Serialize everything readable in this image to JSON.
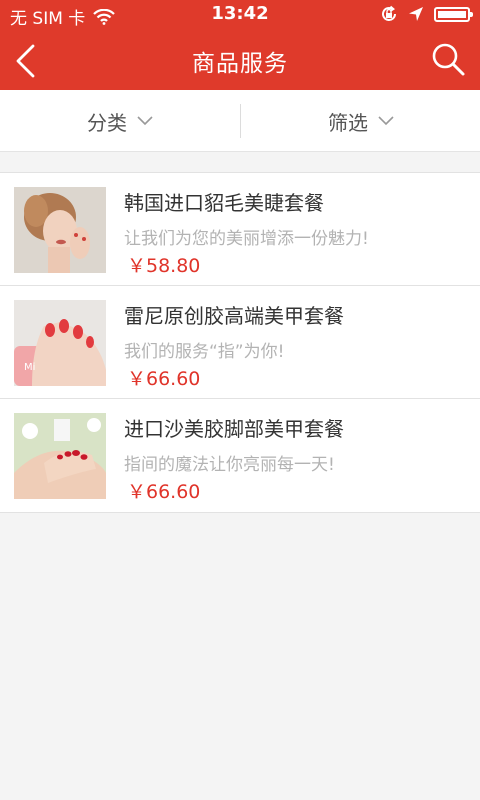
{
  "status_bar": {
    "carrier": "无 SIM 卡",
    "time": "13:42",
    "icons": [
      "wifi-icon",
      "rotation-lock-icon",
      "location-arrow-icon",
      "battery-icon"
    ]
  },
  "nav": {
    "title": "商品服务",
    "back_icon": "chevron-left-icon",
    "search_icon": "search-icon"
  },
  "filters": [
    {
      "label": "分类",
      "icon": "chevron-down-icon"
    },
    {
      "label": "筛选",
      "icon": "chevron-down-icon"
    }
  ],
  "products": [
    {
      "title": "韩国进口貂毛美睫套餐",
      "desc": "让我们为您的美丽增添一份魅力!",
      "price": "￥58.80"
    },
    {
      "title": "雷尼原创胶高端美甲套餐",
      "desc": "我们的服务“指”为你!",
      "price": "￥66.60"
    },
    {
      "title": "进口沙美胶脚部美甲套餐",
      "desc": "指间的魔法让你亮丽每一天!",
      "price": "￥66.60"
    }
  ],
  "colors": {
    "brand_red": "#df3a2b",
    "price_red": "#e0342a"
  }
}
